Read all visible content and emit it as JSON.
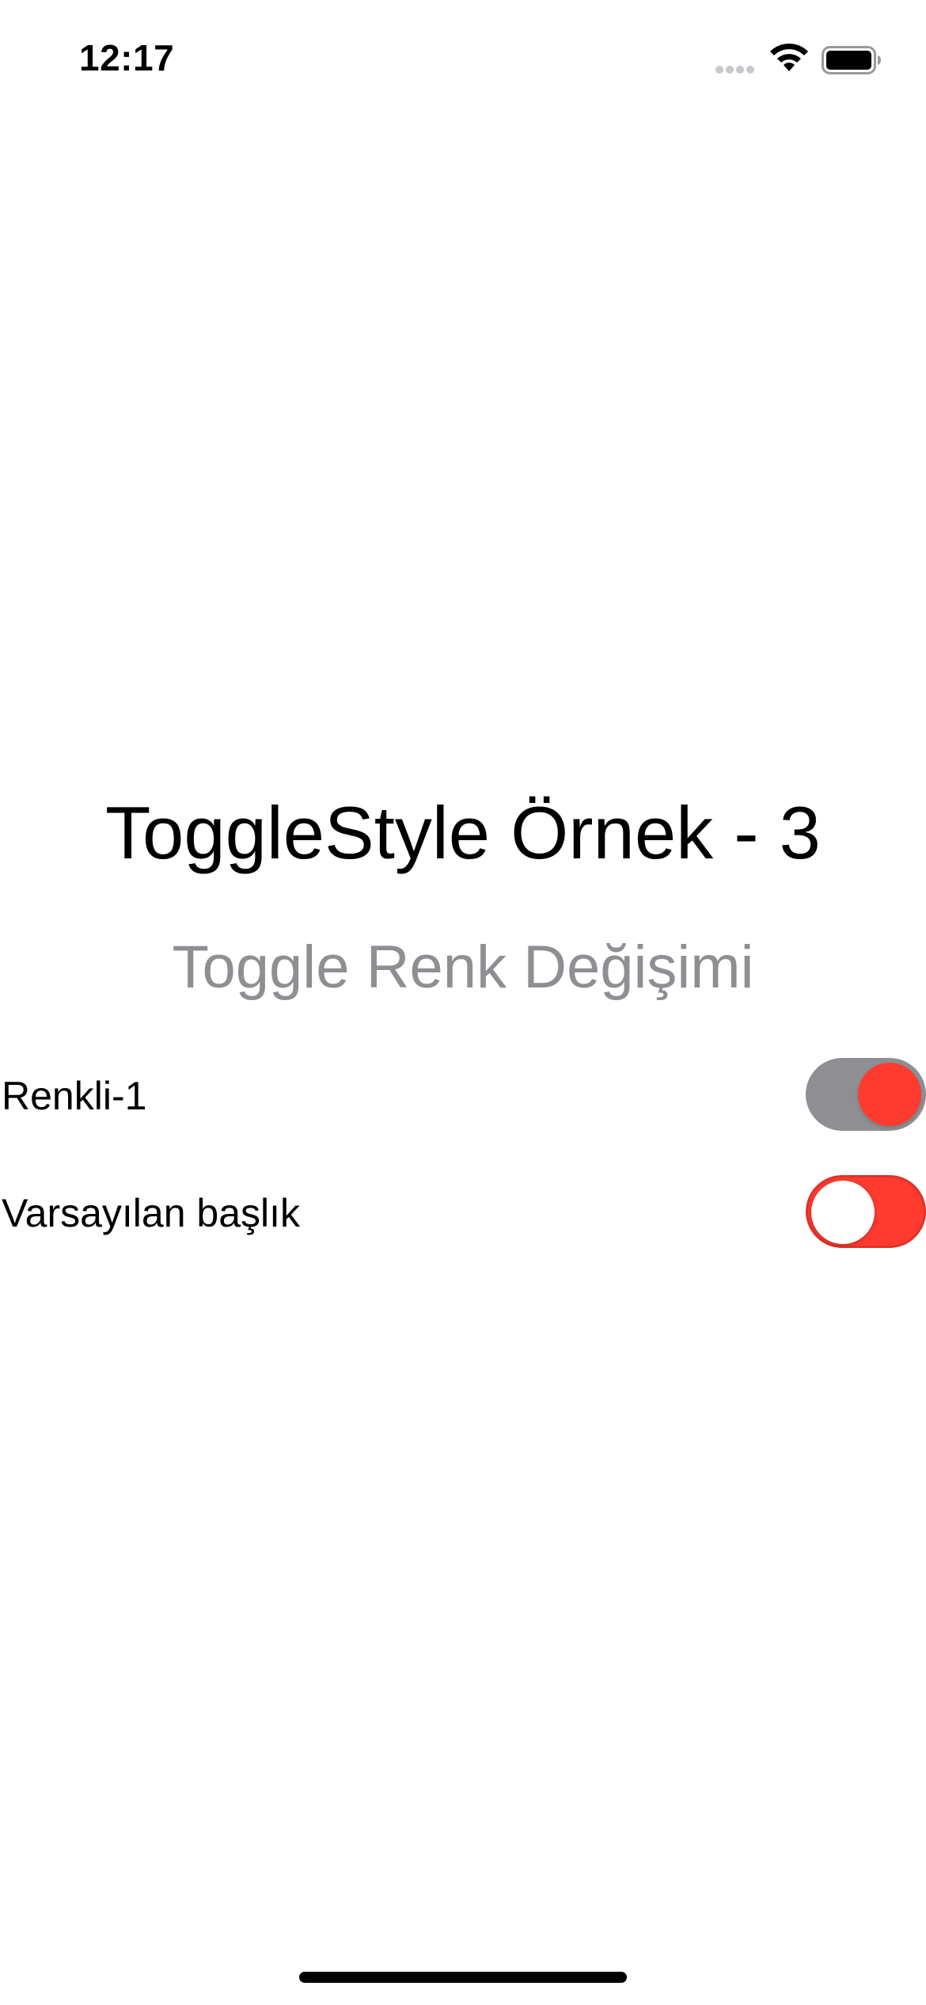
{
  "status_bar": {
    "time": "12:17",
    "icons": [
      "signal-icon",
      "wifi-icon",
      "battery-icon"
    ]
  },
  "main": {
    "title": "ToggleStyle Örnek - 3",
    "subtitle": "Toggle Renk Değişimi",
    "toggles": [
      {
        "label": "Renkli-1",
        "track_color": "#8e8e93",
        "knob_color": "#ff3b30"
      },
      {
        "label": "Varsayılan başlık",
        "track_color": "#ff3b30",
        "knob_color": "#ffffff"
      }
    ]
  },
  "colors": {
    "background": "#ffffff",
    "text": "#000000",
    "secondary_text": "#8e8e93",
    "accent": "#ff3b30"
  }
}
